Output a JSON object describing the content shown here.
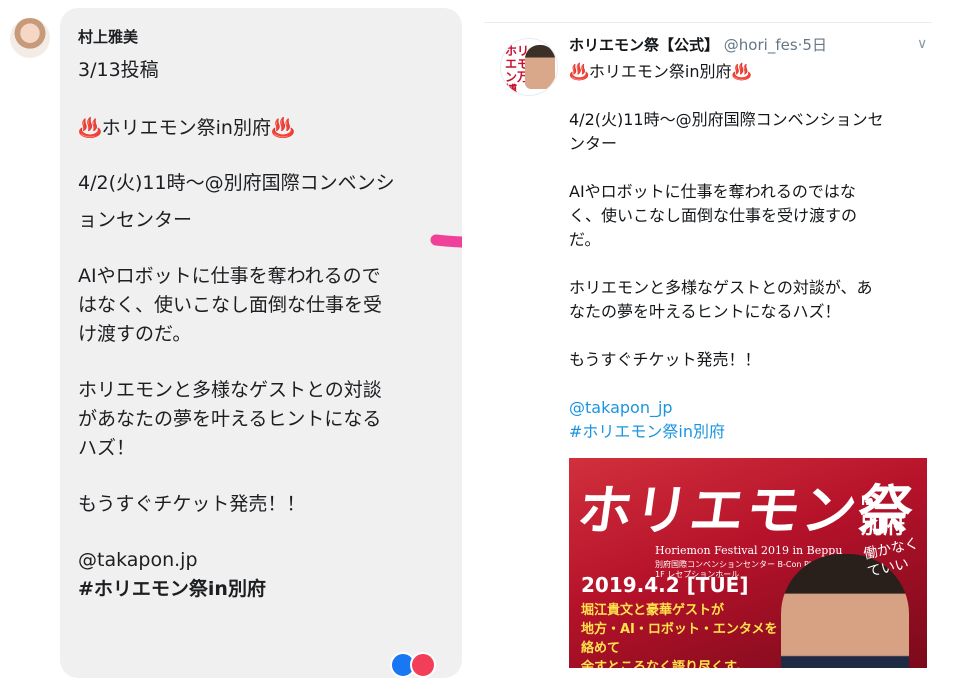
{
  "fb_post": {
    "sender": "村上雅美",
    "date_line": "3/13投稿",
    "headline": "♨️ホリエモン祭in別府♨️",
    "schedule": "4/2(火)11時〜@別府国際コンベンションセンター",
    "schedule_lines": [
      "4/2(火)11時〜@別府国際コンベンシ",
      "ョンセンター"
    ],
    "para1_lines": [
      "AIやロボットに仕事を奪われるので",
      "はなく、使いこなし面倒な仕事を受",
      "け渡すのだ。"
    ],
    "para2_lines": [
      "ホリエモンと多様なゲストとの対談",
      "があなたの夢を叶えるヒントになる",
      "ハズ！"
    ],
    "para3": "もうすぐチケット発売！！",
    "mention": "@takapon.jp",
    "hashtag": "#ホリエモン祭in別府"
  },
  "tweet": {
    "display_name": "ホリエモン祭【公式】",
    "handle": "@hori_fes",
    "separator": "·",
    "time": "5日",
    "avatar_text": "ホリエモン万博",
    "headline": "♨️ホリエモン祭in別府♨️",
    "schedule_lines": [
      "4/2(火)11時〜@別府国際コンベンションセ",
      "ンター"
    ],
    "para1_lines": [
      "AIやロボットに仕事を奪われるのではな",
      "く、使いこなし面倒な仕事を受け渡すの",
      "だ。"
    ],
    "para2_lines": [
      "ホリエモンと多様なゲストとの対談が、あ",
      "なたの夢を叶えるヒントになるハズ！"
    ],
    "para3": "もうすぐチケット発売！！",
    "mention": "@takapon_jp",
    "hashtag": "#ホリエモン祭in別府",
    "poster": {
      "title": "ホリエモン祭",
      "in_label": "in",
      "city": "別府",
      "english_title": "Horiemon Festival 2019 in Beppu",
      "venue_line1": "別府国際コンベンションセンター B-Con Plaza",
      "venue_line2": "1F レセプションホール",
      "date": "2019.4.2 [TUE]",
      "copy_lines": [
        "堀江貴文と豪華ゲストが",
        "地方・AI・ロボット・エンタメを絡めて",
        "余すところなく語り尽くす。"
      ],
      "slogan": "働かなくていい"
    }
  },
  "colors": {
    "arrow": "#f0419a",
    "link": "#1b95e0",
    "bubble": "#f0f0f0",
    "poster_red": "#c21a2f"
  }
}
